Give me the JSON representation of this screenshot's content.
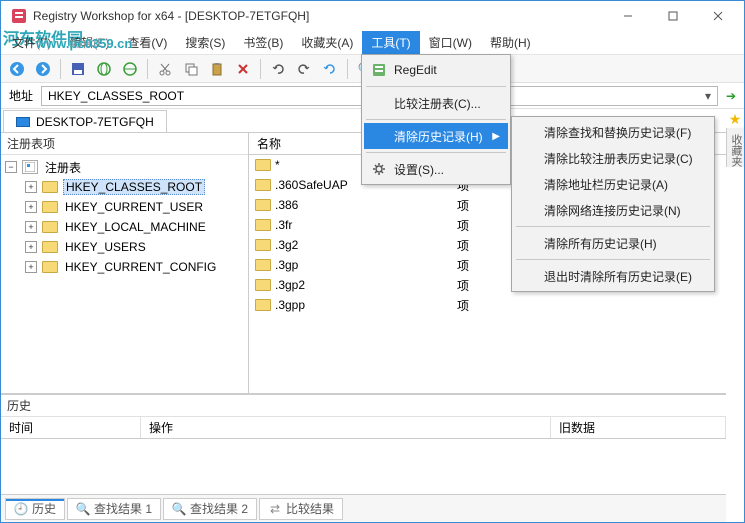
{
  "title": "Registry Workshop for x64 - [DESKTOP-7ETGFQH]",
  "watermark": {
    "text": "河东软件园",
    "url": "www.pc0359.cn"
  },
  "menus": {
    "file": "文件(F)",
    "edit": "编辑(E)",
    "view": "查看(V)",
    "search": "搜索(S)",
    "bookmarks": "书签(B)",
    "favorites": "收藏夹(A)",
    "tools": "工具(T)",
    "window": "窗口(W)",
    "help": "帮助(H)"
  },
  "tools_menu": {
    "regedit": "RegEdit",
    "compare": "比较注册表(C)...",
    "clear_history": "清除历史记录(H)",
    "settings": "设置(S)..."
  },
  "history_submenu": {
    "clear_search": "清除查找和替换历史记录(F)",
    "clear_compare": "清除比较注册表历史记录(C)",
    "clear_address": "清除地址栏历史记录(A)",
    "clear_network": "清除网络连接历史记录(N)",
    "clear_all": "清除所有历史记录(H)",
    "clear_on_exit": "退出时清除所有历史记录(E)"
  },
  "addressbar": {
    "label": "地址",
    "value": "HKEY_CLASSES_ROOT"
  },
  "tab": {
    "computer": "DESKTOP-7ETGFQH"
  },
  "sidebar_label": "收藏夹",
  "tree": {
    "header": "注册表项",
    "root": "注册表",
    "keys": [
      "HKEY_CLASSES_ROOT",
      "HKEY_CURRENT_USER",
      "HKEY_LOCAL_MACHINE",
      "HKEY_USERS",
      "HKEY_CURRENT_CONFIG"
    ]
  },
  "list": {
    "col_name": "名称",
    "type_label": "项",
    "rows": [
      "*",
      ".360SafeUAP",
      ".386",
      ".3fr",
      ".3g2",
      ".3gp",
      ".3gp2",
      ".3gpp"
    ]
  },
  "history": {
    "header": "历史",
    "cols": {
      "time": "时间",
      "op": "操作",
      "old": "旧数据"
    }
  },
  "bottom_tabs": {
    "history": "历史",
    "find1": "查找结果 1",
    "find2": "查找结果 2",
    "compare": "比较结果"
  }
}
